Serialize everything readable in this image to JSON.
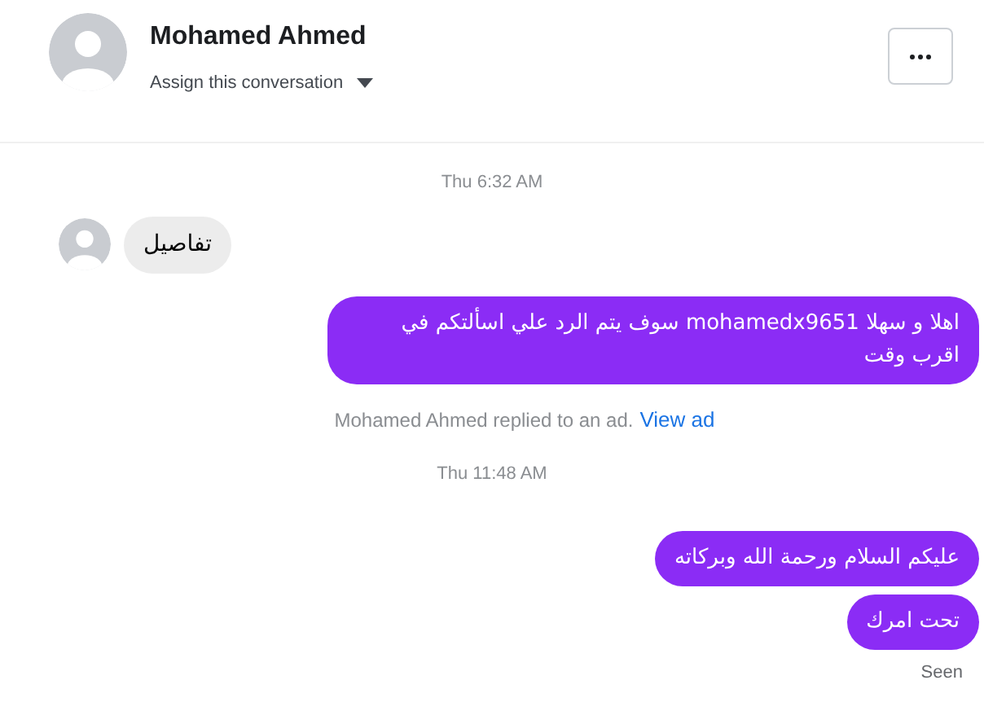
{
  "header": {
    "name": "Mohamed Ahmed",
    "assign_label": "Assign this conversation"
  },
  "messages": [
    {
      "kind": "time",
      "text": "Thu 6:32 AM"
    },
    {
      "kind": "incoming",
      "text": "تفاصيل"
    },
    {
      "kind": "outgoing",
      "text": "اهلا و سهلا mohamedx9651 سوف يتم الرد علي اسألتكم في اقرب وقت"
    },
    {
      "kind": "notice",
      "text": "Mohamed Ahmed replied to an ad.",
      "link": "View ad"
    },
    {
      "kind": "time",
      "text": "Thu 11:48 AM"
    },
    {
      "kind": "outgoing",
      "text": "عليكم السلام ورحمة الله وبركاته"
    },
    {
      "kind": "outgoing",
      "text": "تحت امرك"
    },
    {
      "kind": "seen",
      "text": "Seen"
    }
  ]
}
